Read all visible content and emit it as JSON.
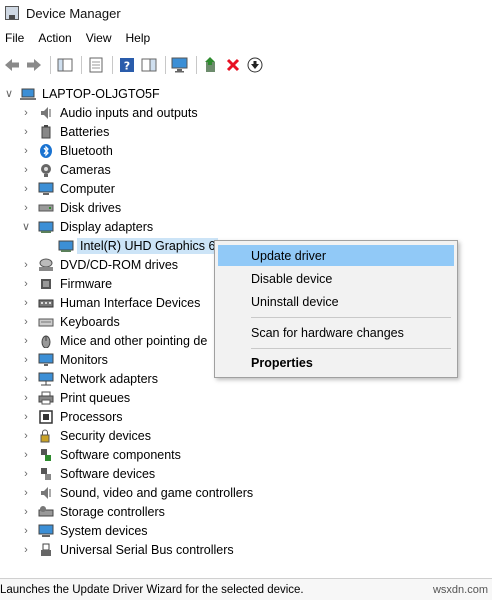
{
  "window": {
    "title": "Device Manager"
  },
  "menubar": [
    "File",
    "Action",
    "View",
    "Help"
  ],
  "tree": {
    "root": "LAPTOP-OLJGTO5F",
    "categories": [
      {
        "label": "Audio inputs and outputs",
        "icon": "speaker-icon"
      },
      {
        "label": "Batteries",
        "icon": "battery-icon"
      },
      {
        "label": "Bluetooth",
        "icon": "bluetooth-icon"
      },
      {
        "label": "Cameras",
        "icon": "camera-icon"
      },
      {
        "label": "Computer",
        "icon": "computer-icon"
      },
      {
        "label": "Disk drives",
        "icon": "disk-drive-icon"
      },
      {
        "label": "Display adapters",
        "icon": "display-adapter-icon",
        "expanded": true,
        "child": {
          "label": "Intel(R) UHD Graphics 6",
          "icon": "display-adapter-icon"
        }
      },
      {
        "label": "DVD/CD-ROM drives",
        "icon": "dvd-icon"
      },
      {
        "label": "Firmware",
        "icon": "firmware-icon"
      },
      {
        "label": "Human Interface Devices",
        "icon": "hid-icon"
      },
      {
        "label": "Keyboards",
        "icon": "keyboard-icon"
      },
      {
        "label": "Mice and other pointing de",
        "icon": "mouse-icon"
      },
      {
        "label": "Monitors",
        "icon": "monitor-icon"
      },
      {
        "label": "Network adapters",
        "icon": "network-icon"
      },
      {
        "label": "Print queues",
        "icon": "printer-icon"
      },
      {
        "label": "Processors",
        "icon": "processor-icon"
      },
      {
        "label": "Security devices",
        "icon": "security-icon"
      },
      {
        "label": "Software components",
        "icon": "software-component-icon"
      },
      {
        "label": "Software devices",
        "icon": "software-device-icon"
      },
      {
        "label": "Sound, video and game controllers",
        "icon": "sound-icon"
      },
      {
        "label": "Storage controllers",
        "icon": "storage-icon"
      },
      {
        "label": "System devices",
        "icon": "system-icon"
      },
      {
        "label": "Universal Serial Bus controllers",
        "icon": "usb-icon"
      }
    ]
  },
  "context_menu": {
    "items": [
      {
        "label": "Update driver",
        "highlighted": true
      },
      {
        "label": "Disable device"
      },
      {
        "label": "Uninstall device"
      },
      {
        "label": "Scan for hardware changes"
      },
      {
        "label": "Properties",
        "bold": true
      }
    ]
  },
  "status": {
    "text": "Launches the Update Driver Wizard for the selected device."
  },
  "watermark": "wsxdn.com",
  "colors": {
    "selection": "#cce4f7",
    "menu_highlight": "#91c9f7",
    "uninstall_red": "#e81123",
    "update_green": "#2e8b2e"
  }
}
